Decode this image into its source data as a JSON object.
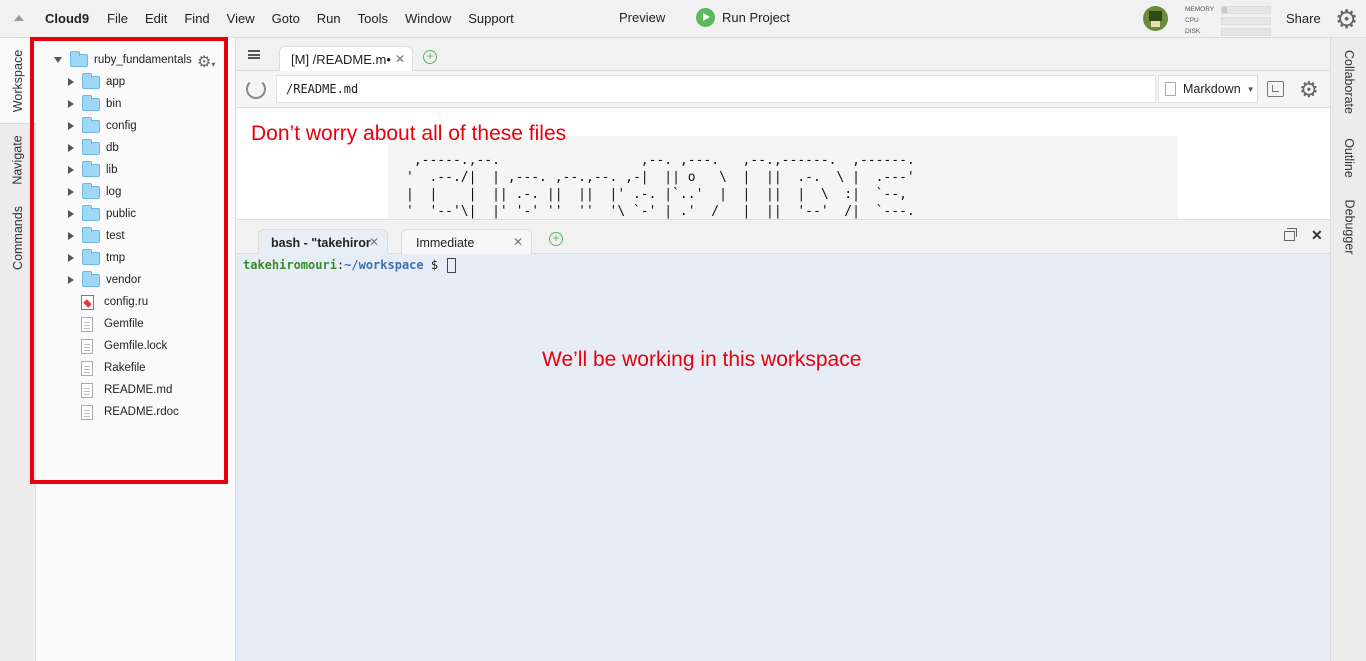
{
  "menubar": {
    "brand": "Cloud9",
    "items": [
      "File",
      "Edit",
      "Find",
      "View",
      "Goto",
      "Run",
      "Tools",
      "Window",
      "Support"
    ],
    "preview": "Preview",
    "run_project": "Run Project",
    "meters": [
      {
        "label": "MEMORY",
        "fill": 0.1
      },
      {
        "label": "CPU",
        "fill": 0.0
      },
      {
        "label": "DISK",
        "fill": 0.0
      }
    ],
    "share": "Share"
  },
  "left_tabs": {
    "workspace": "Workspace",
    "navigate": "Navigate",
    "commands": "Commands"
  },
  "right_tabs": {
    "collaborate": "Collaborate",
    "outline": "Outline",
    "debugger": "Debugger"
  },
  "tree": {
    "root": "ruby_fundamentals",
    "folders": [
      "app",
      "bin",
      "config",
      "db",
      "lib",
      "log",
      "public",
      "test",
      "tmp",
      "vendor"
    ],
    "ruby_files": [
      "config.ru"
    ],
    "files": [
      "Gemfile",
      "Gemfile.lock",
      "Rakefile",
      "README.md",
      "README.rdoc"
    ]
  },
  "editor": {
    "tab_label": "[M] /README.m•",
    "path": "/README.md",
    "mode": "Markdown",
    "annotation": "Don’t worry about all of these files",
    "ascii_lines": [
      " ,-----.,--.                  ,--. ,---.   ,--.,------.  ,------.",
      "'  .--./|  | ,---. ,--.,--. ,-|  || o   \\  |  ||  .-.  \\ |  .---'",
      "|  |    |  || .-. ||  ||  |' .-. |`..'  |  |  ||  |  \\  :|  `--,",
      "'  '--'\\|  |' '-' ''  ''  '\\ `-' | .'  /   |  ||  '--'  /|  `---."
    ]
  },
  "terminal": {
    "tab_active": "bash - \"takehiror",
    "tab_inactive": "Immediate",
    "prompt_user": "takehiromouri",
    "prompt_sep": ":",
    "prompt_dir": "~/workspace",
    "prompt_end": " $ ",
    "annotation": "We’ll be working in this workspace"
  }
}
